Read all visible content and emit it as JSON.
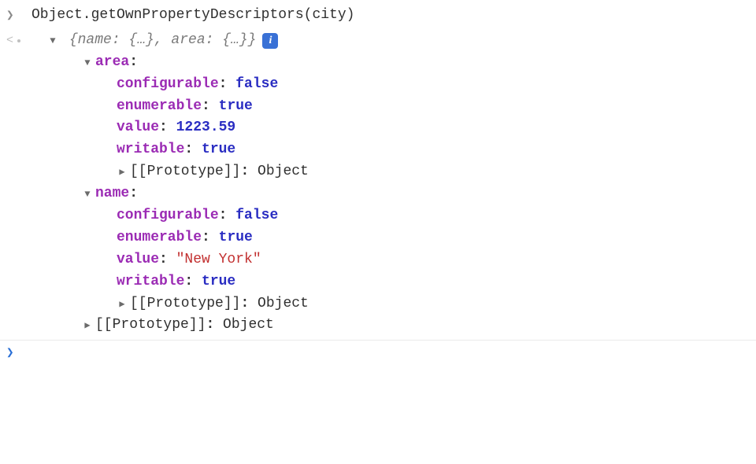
{
  "input_line": "Object.getOwnPropertyDescriptors(city)",
  "summary": "{name: {…}, area: {…}}",
  "info_glyph": "i",
  "obj": {
    "area": {
      "label": "area",
      "props": {
        "configurable": {
          "label": "configurable",
          "value": "false",
          "type": "bool"
        },
        "enumerable": {
          "label": "enumerable",
          "value": "true",
          "type": "bool"
        },
        "value": {
          "label": "value",
          "value": "1223.59",
          "type": "num"
        },
        "writable": {
          "label": "writable",
          "value": "true",
          "type": "bool"
        }
      },
      "proto": {
        "label": "[[Prototype]]",
        "value": "Object"
      }
    },
    "name": {
      "label": "name",
      "props": {
        "configurable": {
          "label": "configurable",
          "value": "false",
          "type": "bool"
        },
        "enumerable": {
          "label": "enumerable",
          "value": "true",
          "type": "bool"
        },
        "value": {
          "label": "value",
          "value": "\"New York\"",
          "type": "str"
        },
        "writable": {
          "label": "writable",
          "value": "true",
          "type": "bool"
        }
      },
      "proto": {
        "label": "[[Prototype]]",
        "value": "Object"
      }
    },
    "proto": {
      "label": "[[Prototype]]",
      "value": "Object"
    }
  }
}
